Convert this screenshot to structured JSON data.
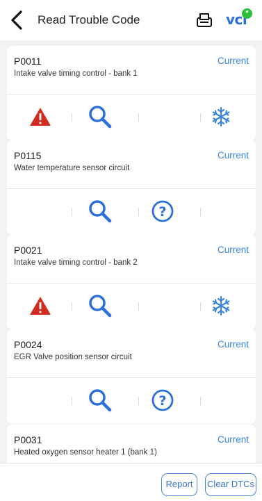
{
  "header": {
    "title": "Read Trouble Code",
    "vci_label": "VCI",
    "vci_dot": "*"
  },
  "dtcs": [
    {
      "code": "P0011",
      "description": "Intake valve timing control - bank 1",
      "status": "Current",
      "actions": [
        "warning-icon",
        "search-icon",
        "",
        "freeze-frame-icon"
      ]
    },
    {
      "code": "P0115",
      "description": "Water temperature sensor circuit",
      "status": "Current",
      "actions": [
        "",
        "search-icon",
        "help-icon",
        ""
      ]
    },
    {
      "code": "P0021",
      "description": "Intake valve timing control - bank 2",
      "status": "Current",
      "actions": [
        "warning-icon",
        "search-icon",
        "",
        "freeze-frame-icon"
      ]
    },
    {
      "code": "P0024",
      "description": "EGR Valve position sensor circuit",
      "status": "Current",
      "actions": [
        "",
        "search-icon",
        "help-icon",
        ""
      ]
    },
    {
      "code": "P0031",
      "description": "Heated oxygen sensor heater 1 (bank 1)",
      "status": "Current",
      "actions": []
    }
  ],
  "footer": {
    "report_label": "Report",
    "clear_label": "Clear DTCs"
  },
  "colors": {
    "accent": "#2d6fd8",
    "warning": "#d52b1e",
    "status_text": "#3a86d8",
    "vci_dot": "#2bbf3b"
  }
}
